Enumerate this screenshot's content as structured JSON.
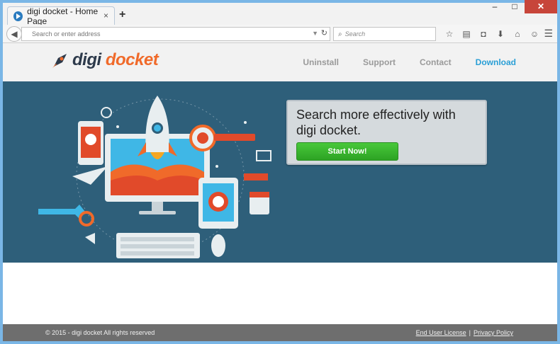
{
  "browser": {
    "tab_title": "digi docket - Home Page",
    "tab_close": "×",
    "new_tab": "+",
    "window_buttons": {
      "minimize": "–",
      "maximize": "□",
      "close": "✕"
    },
    "url_placeholder": "Search or enter address",
    "search_placeholder": "Search",
    "icons": [
      "back-icon",
      "reload-icon",
      "star-icon",
      "reading-list-icon",
      "pocket-icon",
      "download-icon",
      "home-icon",
      "chat-icon",
      "menu-icon"
    ]
  },
  "site": {
    "logo": {
      "part1": "digi",
      "part2": "docket"
    },
    "nav": [
      {
        "label": "Uninstall"
      },
      {
        "label": "Support"
      },
      {
        "label": "Contact"
      },
      {
        "label": "Download"
      }
    ],
    "hero": {
      "headline": "Search more effectively with digi docket.",
      "button": "Start Now!"
    },
    "footer": {
      "copyright": "© 2015 - digi docket All rights reserved",
      "link1": "End User License",
      "separator": "|",
      "link2": "Privacy Policy"
    }
  },
  "colors": {
    "hero_bg": "#2e5f7a",
    "brand_orange": "#f06a2a",
    "brand_dark": "#2d3a4b",
    "accent_blue": "#2a9fd6",
    "cta_green": "#3dbb31"
  }
}
